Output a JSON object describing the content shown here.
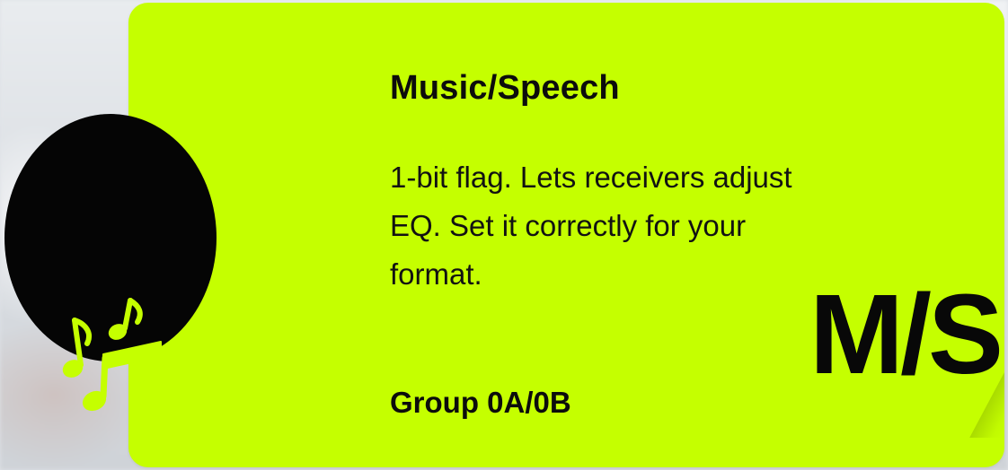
{
  "card": {
    "title": "Music/Speech",
    "description": "1-bit flag. Lets receivers adjust EQ. Set it correctly for your format.",
    "group": "Group 0A/0B",
    "code": "M/S",
    "icon": "music-notes-icon"
  },
  "colors": {
    "accent": "#c5ff00",
    "badge": "#050505",
    "text": "#0c0c0c"
  }
}
